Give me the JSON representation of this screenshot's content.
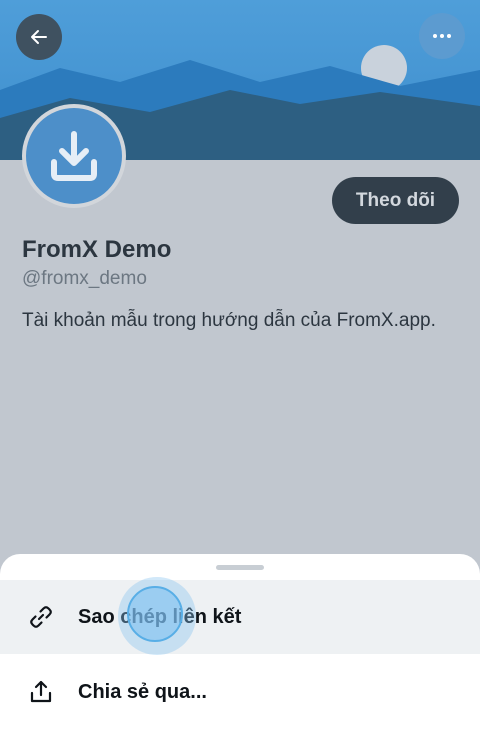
{
  "header": {
    "back_icon": "arrow-left-icon",
    "more_icon": "ellipsis-icon"
  },
  "profile": {
    "display_name": "FromX Demo",
    "handle": "@fromx_demo",
    "bio": "Tài khoản mẫu trong hướng dẫn của FromX.app.",
    "follow_label": "Theo dõi",
    "avatar_icon": "download-icon"
  },
  "share_sheet": {
    "items": [
      {
        "label": "Sao chép liên kết",
        "icon": "link-icon"
      },
      {
        "label": "Chia sẻ qua...",
        "icon": "share-icon"
      }
    ]
  },
  "colors": {
    "sky": "#2f7ebe",
    "mountains_dark": "#3c5a75",
    "mountains_light": "#1e6aa6",
    "avatar": "#4d8fc9",
    "follow_button": "#323f4b",
    "overlay": "#c1c7cf"
  }
}
